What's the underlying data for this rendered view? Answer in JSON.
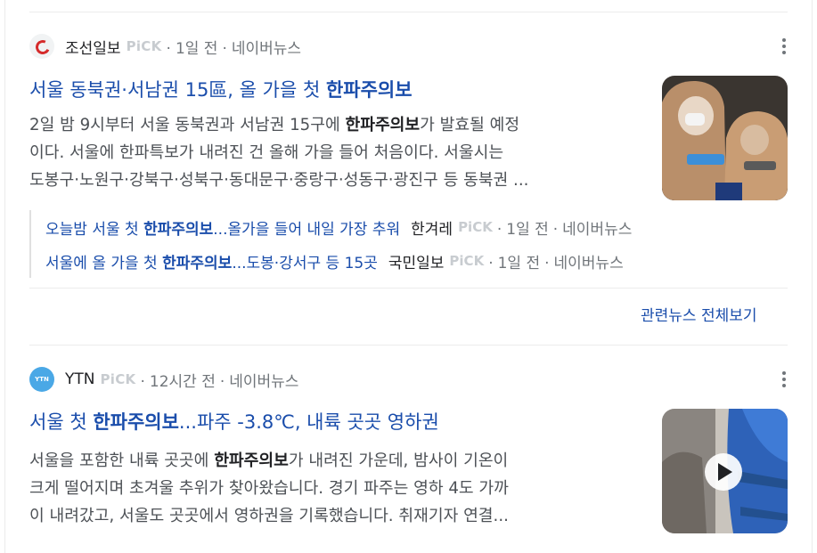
{
  "articles": [
    {
      "press": "조선일보",
      "pick": "PiCK",
      "time": "1일 전",
      "source": "네이버뉴스",
      "title_plain": "서울 동북권·서남권 15區, 올 가을 첫 ",
      "title_bold": "한파주의보",
      "title_after": "",
      "snippet": [
        {
          "before": "2일 밤 9시부터 서울 동북권과 서남권 15구에 ",
          "bold": "한파주의보",
          "after": "가 발효될 예정"
        },
        {
          "before": "이다. 서울에 한파특보가 내려진 건 올해 가을 들어 처음이다. 서울시는",
          "bold": "",
          "after": ""
        },
        {
          "before": "도봉구·노원구·강북구·성북구·동대문구·중랑구·성동구·광진구 등 동북권 ...",
          "bold": "",
          "after": ""
        }
      ],
      "related": [
        {
          "before": "오늘밤 서울 첫 ",
          "bold": "한파주의보",
          "after": "...올가을 들어 내일 가장 추워",
          "press": "한겨레",
          "pick": "PiCK",
          "time": "1일 전",
          "source": "네이버뉴스"
        },
        {
          "before": "서울에 올 가을 첫 ",
          "bold": "한파주의보",
          "after": "...도봉·강서구 등 15곳",
          "press": "국민일보",
          "pick": "PiCK",
          "time": "1일 전",
          "source": "네이버뉴스"
        }
      ],
      "more_label": "관련뉴스 전체보기"
    },
    {
      "press": "YTN",
      "logo_text": "YTN",
      "pick": "PiCK",
      "time": "12시간 전",
      "source": "네이버뉴스",
      "title_plain": "서울 첫 ",
      "title_bold": "한파주의보",
      "title_after": "...파주 -3.8℃, 내륙 곳곳 영하권",
      "snippet": [
        {
          "before": "서울을 포함한 내륙 곳곳에 ",
          "bold": "한파주의보",
          "after": "가 내려진 가운데, 밤사이 기온이"
        },
        {
          "before": "크게 떨어지며 초겨울 추위가 찾아왔습니다. 경기 파주는 영하 4도 가까",
          "bold": "",
          "after": ""
        },
        {
          "before": "이 내려갔고, 서울도 곳곳에서 영하권을 기록했습니다. 취재기자 연결...",
          "bold": "",
          "after": ""
        }
      ]
    }
  ],
  "colors": {
    "link": "#1a4dab",
    "meta": "#70757a",
    "snippet": "#4d5156"
  }
}
